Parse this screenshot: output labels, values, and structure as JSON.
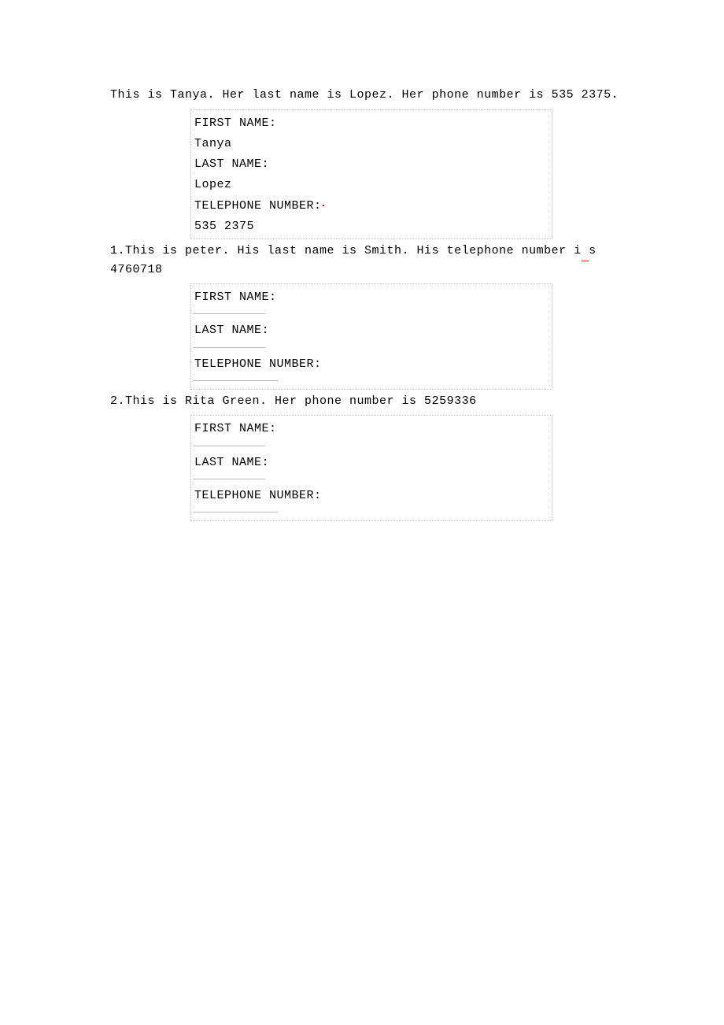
{
  "examples": [
    {
      "intro": "This is Tanya. Her last name is Lopez. Her phone number is 535 2375.",
      "prefix": "",
      "first_name_label": "FIRST NAME:",
      "first_name_value": "Tanya",
      "last_name_label": "LAST NAME:",
      "last_name_value": "Lopez",
      "telephone_label_pre": "TELEPHONE NUMBER:",
      "telephone_value": "535 2375",
      "has_values": true,
      "has_red_dot": true
    },
    {
      "intro_pre": "1.This is peter. His last name is Smith. His telephone number i",
      "intro_post": "s 4760718",
      "first_name_label": "FIRST NAME:",
      "last_name_label": "LAST NAME:",
      "telephone_label": "TELEPHONE NUMBER:",
      "has_values": false,
      "has_red_under": true
    },
    {
      "intro": "2.This is Rita Green. Her phone number is 5259336",
      "first_name_label": "FIRST NAME:",
      "last_name_label": "LAST NAME:",
      "telephone_label": "TELEPHONE NUMBER:",
      "has_values": false
    }
  ]
}
